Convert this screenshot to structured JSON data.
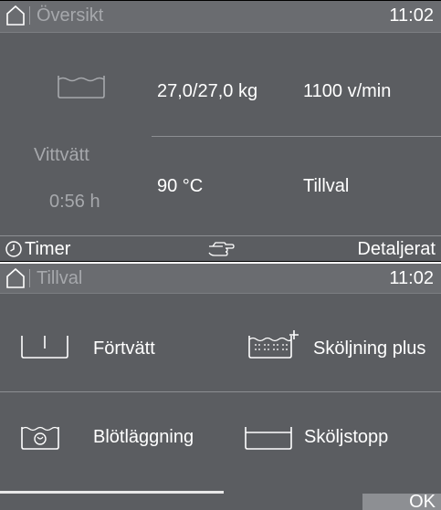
{
  "overview": {
    "title": "Översikt",
    "time": "11:02",
    "program": "Vittvätt",
    "duration": "0:56 h",
    "load": "27,0/27,0 kg",
    "spin": "1100 v/min",
    "temperature": "90 °C",
    "options_label": "Tillval",
    "footer": {
      "timer_label": "Timer",
      "details_label": "Detaljerat"
    }
  },
  "options": {
    "title": "Tillval",
    "time": "11:02",
    "items": [
      {
        "label": "Förtvätt",
        "icon": "prewash-icon"
      },
      {
        "label": "Sköljning plus",
        "icon": "rinse-plus-icon"
      },
      {
        "label": "Blötläggning",
        "icon": "soak-icon"
      },
      {
        "label": "Sköljstopp",
        "icon": "rinse-hold-icon"
      }
    ],
    "ok_label": "OK"
  },
  "colors": {
    "panel": "#5b5d61",
    "header": "#6a6c70",
    "dim_text": "#a6a8ac",
    "divider": "#8d8f93"
  }
}
